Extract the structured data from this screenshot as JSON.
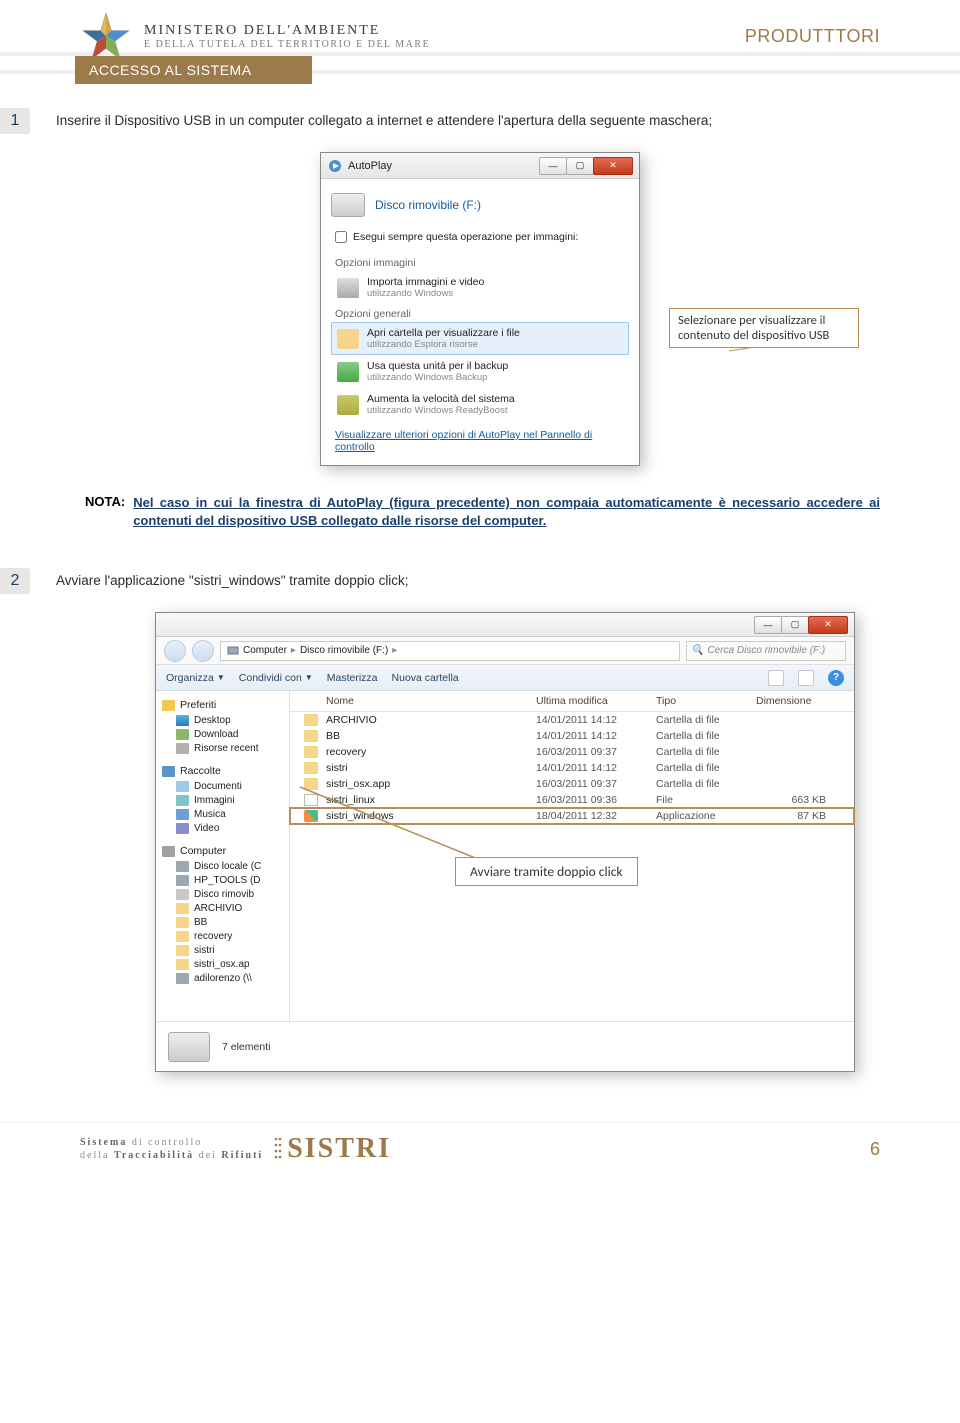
{
  "header": {
    "ministry_line1": "MINISTERO DELL'AMBIENTE",
    "ministry_line2": "E DELLA TUTELA DEL TERRITORIO E DEL MARE",
    "produttori": "PRODUTTTORI"
  },
  "section_title": "ACCESSO AL SISTEMA",
  "step1": {
    "num": "1",
    "text": "Inserire il Dispositivo USB in un computer collegato a internet e attendere l'apertura della seguente maschera;"
  },
  "autoplay": {
    "title": "AutoPlay",
    "drive_label": "Disco rimovibile (F:)",
    "checkbox": "Esegui sempre questa operazione per immagini:",
    "group_images": "Opzioni immagini",
    "item_import": {
      "t1": "Importa immagini e video",
      "t2": "utilizzando Windows"
    },
    "group_general": "Opzioni generali",
    "item_open": {
      "t1": "Apri cartella per visualizzare i file",
      "t2": "utilizzando Esplora risorse"
    },
    "item_backup": {
      "t1": "Usa questa unità per il backup",
      "t2": "utilizzando Windows Backup"
    },
    "item_speed": {
      "t1": "Aumenta la velocità del sistema",
      "t2": "utilizzando Windows ReadyBoost"
    },
    "link_more": "Visualizzare ulteriori opzioni di AutoPlay nel Pannello di controllo"
  },
  "callout1": "Selezionare per visualizzare il contenuto del dispositivo USB",
  "nota": {
    "label": "NOTA:",
    "text": "Nel caso in cui la finestra di AutoPlay (figura precedente) non compaia automaticamente è necessario accedere ai contenuti del dispositivo USB collegato dalle risorse del computer."
  },
  "step2": {
    "num": "2",
    "text": "Avviare l'applicazione \"sistri_windows\" tramite doppio click;"
  },
  "explorer": {
    "breadcrumb": [
      "Computer",
      "Disco rimovibile (F:)"
    ],
    "search_placeholder": "Cerca Disco rimovibile (F:)",
    "toolbar": {
      "organize": "Organizza",
      "share": "Condividi con",
      "burn": "Masterizza",
      "newfolder": "Nuova cartella"
    },
    "columns": {
      "name": "Nome",
      "date": "Ultima modifica",
      "type": "Tipo",
      "size": "Dimensione"
    },
    "sidebar": {
      "favorites": {
        "head": "Preferiti",
        "items": [
          "Desktop",
          "Download",
          "Risorse recent"
        ]
      },
      "libraries": {
        "head": "Raccolte",
        "items": [
          "Documenti",
          "Immagini",
          "Musica",
          "Video"
        ]
      },
      "computer": {
        "head": "Computer",
        "items": [
          "Disco locale (C",
          "HP_TOOLS (D",
          "Disco rimovib",
          "ARCHIVIO",
          "BB",
          "recovery",
          "sistri",
          "sistri_osx.ap",
          "adilorenzo (\\\\"
        ]
      }
    },
    "rows": [
      {
        "name": "ARCHIVIO",
        "date": "14/01/2011 14:12",
        "type": "Cartella di file",
        "size": "",
        "icon": "folder"
      },
      {
        "name": "BB",
        "date": "14/01/2011 14:12",
        "type": "Cartella di file",
        "size": "",
        "icon": "folder"
      },
      {
        "name": "recovery",
        "date": "16/03/2011 09:37",
        "type": "Cartella di file",
        "size": "",
        "icon": "folder"
      },
      {
        "name": "sistri",
        "date": "14/01/2011 14:12",
        "type": "Cartella di file",
        "size": "",
        "icon": "folder"
      },
      {
        "name": "sistri_osx.app",
        "date": "16/03/2011 09:37",
        "type": "Cartella di file",
        "size": "",
        "icon": "folder"
      },
      {
        "name": "sistri_linux",
        "date": "16/03/2011 09:36",
        "type": "File",
        "size": "663 KB",
        "icon": "file"
      },
      {
        "name": "sistri_windows",
        "date": "18/04/2011 12:32",
        "type": "Applicazione",
        "size": "87 KB",
        "icon": "exe"
      }
    ],
    "status": "7 elementi"
  },
  "callout2": "Avviare tramite doppio click",
  "footer": {
    "line1_a": "Sistema",
    "line1_b": " di controllo",
    "line2_a": "della ",
    "line2_b": "Tracciabilità",
    "line2_c": " dei ",
    "line2_d": "Rifiuti",
    "logo": "SISTRI",
    "pagenum": "6"
  }
}
